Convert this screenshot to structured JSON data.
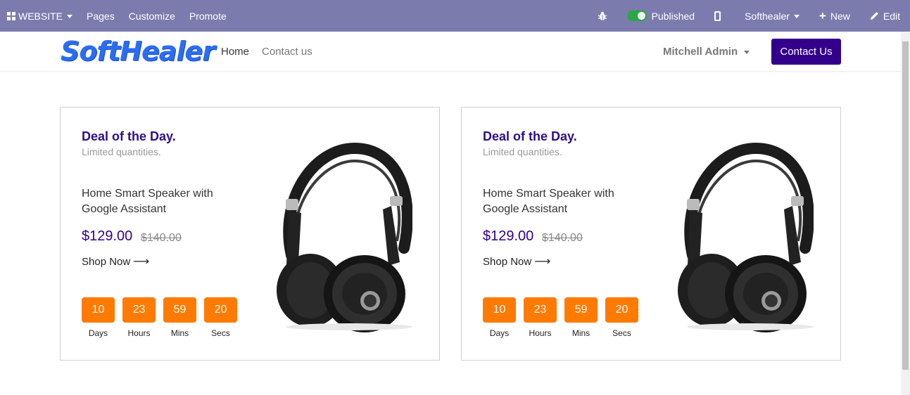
{
  "adminbar": {
    "website": "WEBSITE",
    "pages": "Pages",
    "customize": "Customize",
    "promote": "Promote",
    "published": "Published",
    "company": "Softhealer",
    "new": "New",
    "edit": "Edit"
  },
  "header": {
    "logo": "SoftHealer",
    "nav": [
      "Home",
      "Contact us"
    ],
    "user": "Mitchell Admin",
    "contact_button": "Contact Us"
  },
  "cards": [
    {
      "title": "Deal of the Day.",
      "subtitle": "Limited quantities.",
      "product": "Home Smart Speaker with Google Assistant",
      "price": "$129.00",
      "old_price": "$140.00",
      "shop": "Shop Now",
      "timer": [
        {
          "value": "10",
          "label": "Days"
        },
        {
          "value": "23",
          "label": "Hours"
        },
        {
          "value": "59",
          "label": "Mins"
        },
        {
          "value": "20",
          "label": "Secs"
        }
      ]
    },
    {
      "title": "Deal of the Day.",
      "subtitle": "Limited quantities.",
      "product": "Home Smart Speaker with Google Assistant",
      "price": "$129.00",
      "old_price": "$140.00",
      "shop": "Shop Now",
      "timer": [
        {
          "value": "10",
          "label": "Days"
        },
        {
          "value": "23",
          "label": "Hours"
        },
        {
          "value": "59",
          "label": "Mins"
        },
        {
          "value": "20",
          "label": "Secs"
        }
      ]
    }
  ],
  "colors": {
    "adminbar": "#7c7bad",
    "primary": "#33008c",
    "timer": "#ff7a00",
    "published_toggle": "#28a745"
  }
}
